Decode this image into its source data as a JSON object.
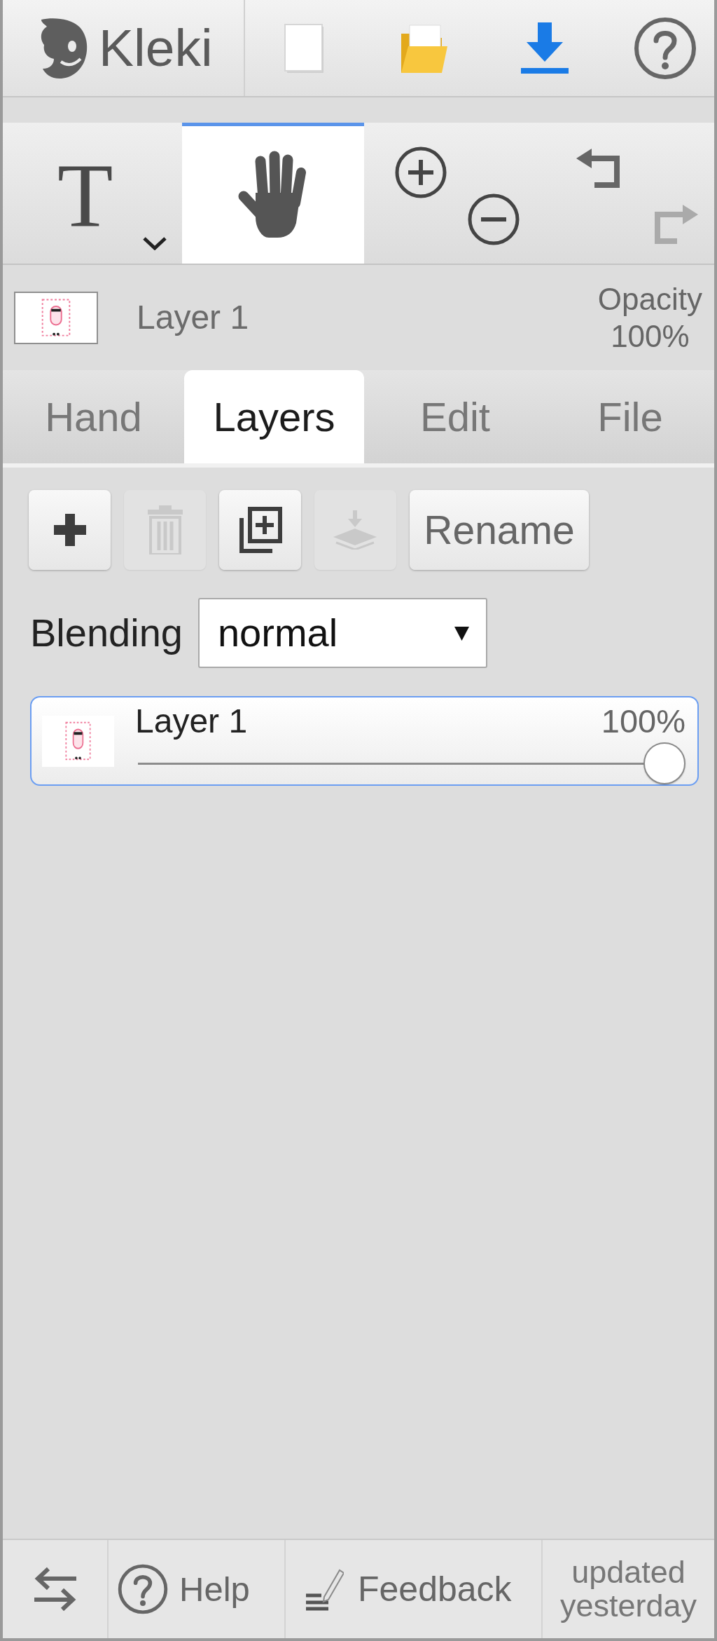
{
  "header": {
    "logo": "Kleki",
    "actions": [
      {
        "kind": "new"
      },
      {
        "kind": "open"
      },
      {
        "kind": "download"
      },
      {
        "kind": "help"
      }
    ]
  },
  "toolbar": {
    "tools": [
      {
        "kind": "text",
        "glyph": "T",
        "selected": false
      },
      {
        "kind": "hand",
        "selected": true
      }
    ],
    "zoom": [
      {
        "kind": "zoom_in"
      },
      {
        "kind": "zoom_out"
      }
    ],
    "history": [
      {
        "kind": "undo",
        "disabled": false
      },
      {
        "kind": "redo",
        "disabled": true
      }
    ]
  },
  "current_layer": {
    "name": "Layer 1",
    "opacity_label": "Opacity",
    "opacity": "100%"
  },
  "tabs": [
    {
      "label": "Hand",
      "selected": false
    },
    {
      "label": "Layers",
      "selected": true
    },
    {
      "label": "Edit",
      "selected": false
    },
    {
      "label": "File",
      "selected": false
    }
  ],
  "layer_actions": [
    {
      "kind": "add",
      "disabled": false
    },
    {
      "kind": "delete",
      "disabled": true
    },
    {
      "kind": "duplicate",
      "disabled": false
    },
    {
      "kind": "merge_down",
      "disabled": true
    },
    {
      "kind": "rename",
      "label": "Rename",
      "disabled": false
    }
  ],
  "blending": {
    "label": "Blending",
    "value": "normal"
  },
  "layers": [
    {
      "name": "Layer 1",
      "opacity": "100%",
      "level": 1,
      "selected": true
    }
  ],
  "footer": [
    {
      "kind": "swap"
    },
    {
      "kind": "help",
      "label": "Help"
    },
    {
      "kind": "feedback",
      "label": "Feedback"
    },
    {
      "kind": "status",
      "label": "updated yesterday"
    }
  ]
}
